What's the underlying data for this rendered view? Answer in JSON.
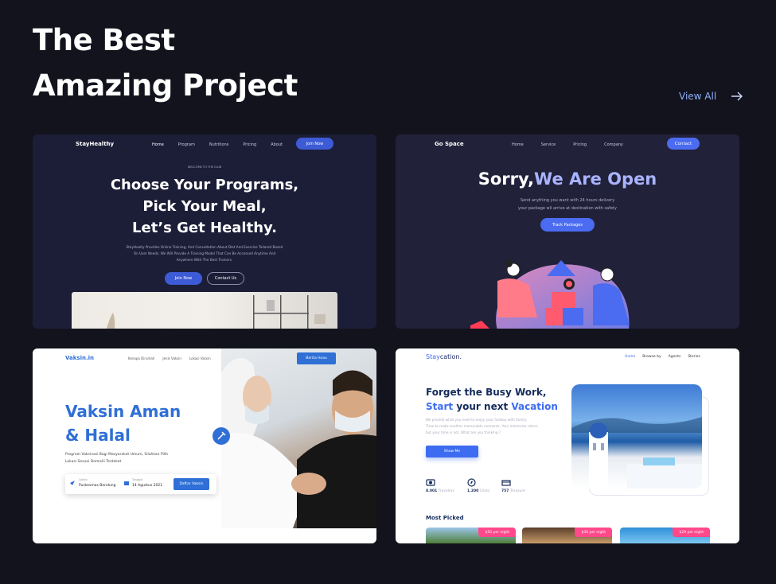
{
  "header": {
    "title_line1": "The Best",
    "title_line2": "Amazing Project",
    "view_all": "View All"
  },
  "cards": {
    "stayhealthy": {
      "logo": "StayHealthy",
      "nav": [
        "Home",
        "Program",
        "Nutritions",
        "Pricing",
        "About"
      ],
      "join": "Join Now",
      "eyebrow": "WELCOME TO THE CLUB",
      "headline1": "Choose Your Programs,",
      "headline2": "Pick Your Meal,",
      "headline3": "Let’s Get Healthy.",
      "desc1": "StayHealty Provides Online Training, And Consultation About Diet And Exercise Tailored Based",
      "desc2": "On User Needs. We Will Provide A Training Model That Can Be Accessed Anytime And",
      "desc3": "Anywhere With The Best Trainers.",
      "btn_join": "Join Now",
      "btn_contact": "Contact Us"
    },
    "gospace": {
      "logo": "Go Space",
      "nav": [
        "Home",
        "Service",
        "Pricing",
        "Company"
      ],
      "contact": "Contact",
      "headline_a": "Sorry,",
      "headline_b": "We Are Open",
      "desc1": "Send anything you want with 24 hours delivery",
      "desc2": "your package wil arrive at destination with safety",
      "track": "Track Packages"
    },
    "vaksin": {
      "logo": "Vaksin.in",
      "nav": [
        "Kenapa Dirumah",
        "Jenis Vaksin",
        "Lokasi Vaksin"
      ],
      "berita": "Berita Hoax",
      "headline1": "Vaksin Aman",
      "headline2": "& Halal",
      "desc1": "Program Vaksinasi Bagi Masyarakat Umum, Silahkan Pilih",
      "desc2": "Lokasi Sesuai Domisili Terdekat",
      "lokasi_label": "Lokasi",
      "lokasi_value": "Puskesmas Bendung",
      "tanggal_label": "Tanggal",
      "tanggal_value": "14 Agustus 2021",
      "daftar": "Daftar Vaksin"
    },
    "staycation": {
      "logo_a": "Stay",
      "logo_b": "cation.",
      "nav": [
        "Home",
        "Browse by",
        "Agents",
        "Stories"
      ],
      "headline1": "Forget the Busy Work,",
      "headline2_a": "Start",
      "headline2_b": " your next ",
      "headline2_c": "Vacation",
      "desc1": "We provide what you need to enjoy your holiday with family.",
      "desc2": "Time to make another memorable moments. Your memories return",
      "desc3": "but your time is not. What are you thinking ?",
      "show_me": "Show Me",
      "stats": [
        {
          "value": "8.001",
          "unit": "Travelers"
        },
        {
          "value": "1.200",
          "unit": "Cities"
        },
        {
          "value": "757",
          "unit": "Treasure"
        }
      ],
      "most_picked": "Most Picked",
      "prices": [
        "$50 per night",
        "$30 per night",
        "$29 per night"
      ]
    }
  }
}
